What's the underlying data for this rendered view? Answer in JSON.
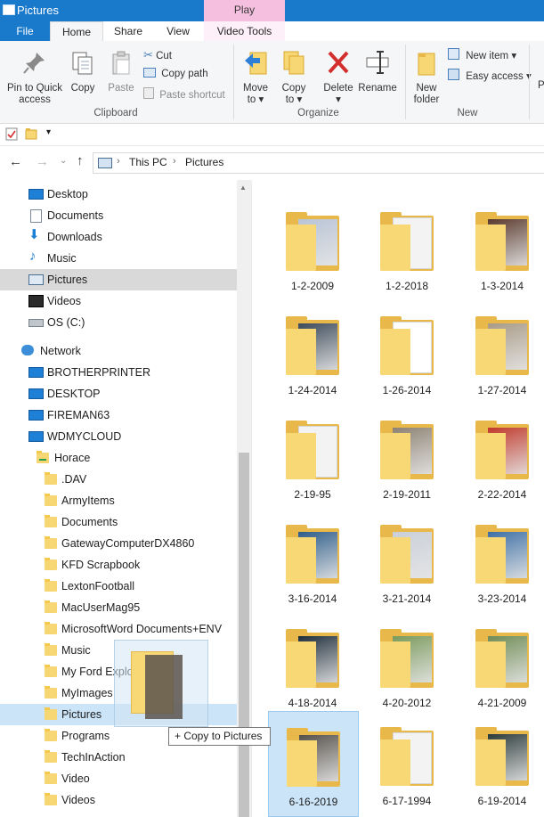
{
  "window": {
    "title": "Pictures",
    "context_tab": "Play"
  },
  "tabs": [
    "File",
    "Home",
    "Share",
    "View",
    "Video Tools"
  ],
  "ribbon": {
    "clipboard": {
      "pin": [
        "Pin to Quick",
        "access"
      ],
      "copy": "Copy",
      "paste": "Paste",
      "cut": "Cut",
      "copy_path": "Copy path",
      "paste_shortcut": "Paste shortcut",
      "group": "Clipboard"
    },
    "organize": {
      "move_to": [
        "Move",
        "to"
      ],
      "copy_to": [
        "Copy",
        "to"
      ],
      "delete": "Delete",
      "rename": "Rename",
      "group": "Organize"
    },
    "new": {
      "new_folder": [
        "New",
        "folder"
      ],
      "new_item": "New item",
      "easy_access": "Easy access",
      "group": "New"
    },
    "partial": "P"
  },
  "address": {
    "segments": [
      "This PC",
      "Pictures"
    ]
  },
  "nav": {
    "quick": [
      {
        "label": "Desktop",
        "icon": "desktop-icon"
      },
      {
        "label": "Documents",
        "icon": "documents-icon"
      },
      {
        "label": "Downloads",
        "icon": "downloads-icon"
      },
      {
        "label": "Music",
        "icon": "music-icon"
      },
      {
        "label": "Pictures",
        "icon": "pictures-icon"
      },
      {
        "label": "Videos",
        "icon": "videos-icon"
      },
      {
        "label": "OS (C:)",
        "icon": "drive-icon"
      }
    ],
    "network": {
      "label": "Network",
      "computers": [
        "BROTHERPRINTER",
        "DESKTOP",
        "FIREMAN63",
        "WDMYCLOUD"
      ],
      "share": "Horace",
      "folders": [
        ".DAV",
        "ArmyItems",
        "Documents",
        "GatewayComputerDX4860",
        "KFD Scrapbook",
        "LextonFootball",
        "MacUserMag95",
        "MicrosoftWord Documents+ENV",
        "Music",
        "My Ford Explorer",
        "MyImages",
        "Pictures",
        "Programs",
        "TechInAction",
        "Video",
        "Videos"
      ]
    }
  },
  "folders": [
    {
      "name": "1-2-2009",
      "kind": "photo",
      "tint": "#b8c4d6"
    },
    {
      "name": "1-2-2018",
      "kind": "paper",
      "tint": "#f3f3f3"
    },
    {
      "name": "1-3-2014",
      "kind": "photo",
      "tint": "#5a3a2e"
    },
    {
      "name": "1-24-2014",
      "kind": "photo",
      "tint": "#3c4a5a"
    },
    {
      "name": "1-26-2014",
      "kind": "paper",
      "tint": "#ffffff"
    },
    {
      "name": "1-27-2014",
      "kind": "photo",
      "tint": "#a89a86"
    },
    {
      "name": "2-19-95",
      "kind": "paper",
      "tint": "#f3f3f3"
    },
    {
      "name": "2-19-2011",
      "kind": "photo",
      "tint": "#8d8273"
    },
    {
      "name": "2-22-2014",
      "kind": "photo",
      "tint": "#c0392b"
    },
    {
      "name": "3-16-2014",
      "kind": "photo",
      "tint": "#2e5d8a"
    },
    {
      "name": "3-21-2014",
      "kind": "photo",
      "tint": "#c9cfd8"
    },
    {
      "name": "3-23-2014",
      "kind": "photo",
      "tint": "#3d6fa5"
    },
    {
      "name": "4-18-2014",
      "kind": "photo",
      "tint": "#1f2e3c"
    },
    {
      "name": "4-20-2012",
      "kind": "photo",
      "tint": "#7a9a5c"
    },
    {
      "name": "4-21-2009",
      "kind": "photo",
      "tint": "#6f8c55"
    },
    {
      "name": "6-16-2019",
      "kind": "photo",
      "tint": "#55504a",
      "selected": true
    },
    {
      "name": "6-17-1994",
      "kind": "paper",
      "tint": "#f3f3f3"
    },
    {
      "name": "6-19-2014",
      "kind": "photo",
      "tint": "#2b3a3a"
    }
  ],
  "drag_tip": "+ Copy to Pictures",
  "colors": {
    "accent": "#1979ca",
    "selection": "#cce4f7",
    "folder": "#f8d775"
  }
}
